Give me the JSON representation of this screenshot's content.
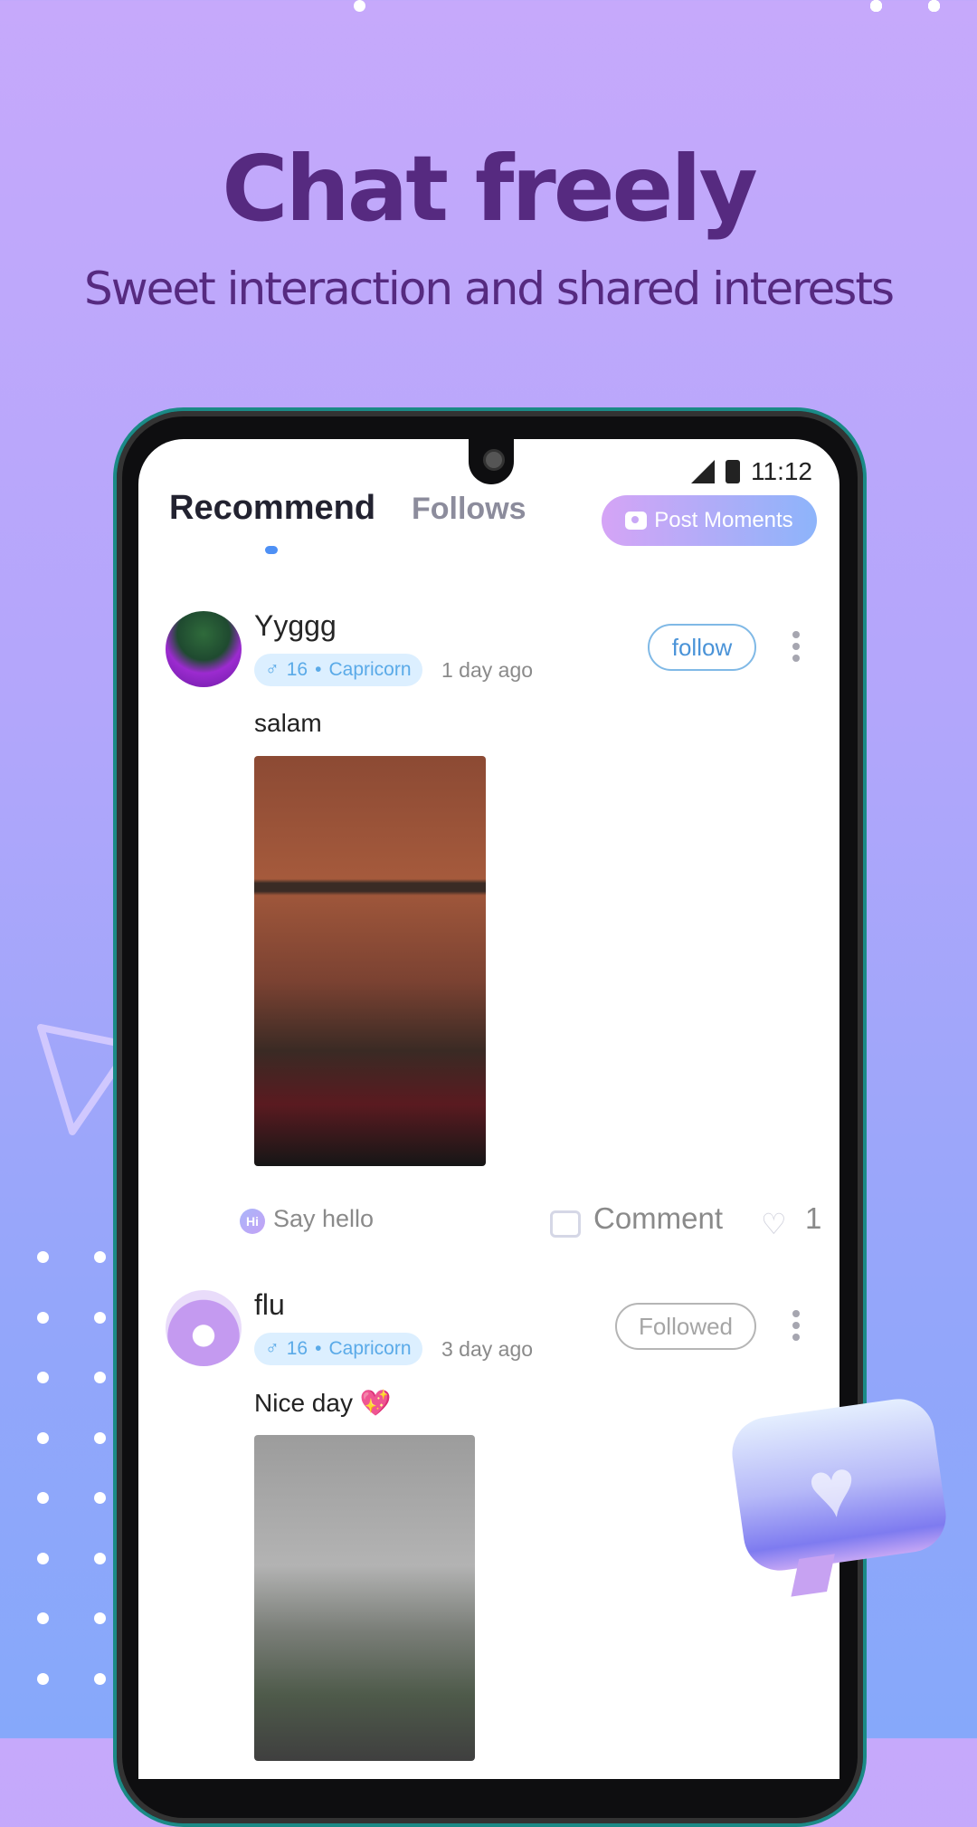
{
  "promo": {
    "headline": "Chat freely",
    "subheadline": "Sweet interaction and shared interests"
  },
  "status_bar": {
    "time": "11:12"
  },
  "header": {
    "tabs": [
      {
        "label": "Recommend",
        "active": true
      },
      {
        "label": "Follows",
        "active": false
      }
    ],
    "post_button_label": "Post Moments"
  },
  "feed": [
    {
      "username": "Yyggg",
      "gender_symbol": "♂",
      "age": "16",
      "zodiac": "Capricorn",
      "time_ago": "1 day ago",
      "follow_label": "follow",
      "content": "salam",
      "say_hello_label": "Say hello",
      "comment_label": "Comment",
      "likes": "1"
    },
    {
      "username": "flu",
      "gender_symbol": "♂",
      "age": "16",
      "zodiac": "Capricorn",
      "time_ago": "3 day ago",
      "follow_label": "Followed",
      "content": "Nice day 💖"
    }
  ],
  "icons": {
    "hi": "Hi",
    "heart": "♡",
    "bubble_heart": "♥",
    "separator": "•"
  },
  "colors": {
    "headline": "#562a80",
    "accent_blue": "#4e90f5",
    "badge_bg": "#dcefff",
    "badge_text": "#5aaae8"
  }
}
